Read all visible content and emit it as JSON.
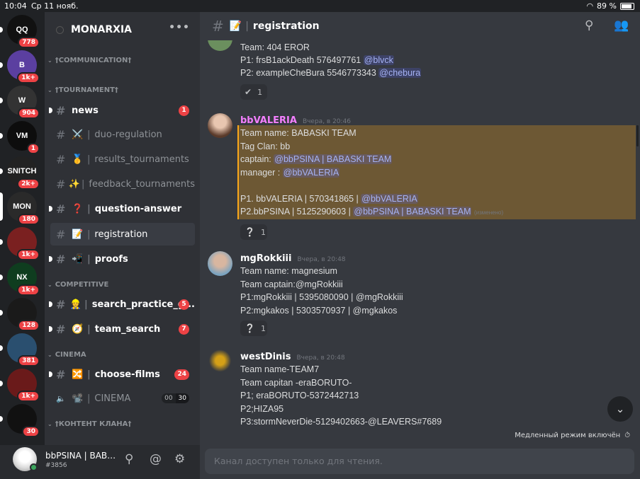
{
  "statusbar": {
    "time": "10:04",
    "date": "Ср 11 нояб.",
    "battery": "89 %",
    "battery_level": 0.89
  },
  "servers": [
    {
      "icon": "qq-server-icon",
      "label": "QQ",
      "bg": "#111111",
      "badge": "778"
    },
    {
      "icon": "b-server-icon",
      "label": "B",
      "bg": "#5b3fa0",
      "badge": "1k+"
    },
    {
      "icon": "w-server-icon",
      "label": "W",
      "bg": "#333333",
      "badge": "904"
    },
    {
      "icon": "vm-server-icon",
      "label": "VM",
      "bg": "#0d0d0d",
      "badge": "1"
    },
    {
      "icon": "snitch-server-icon",
      "label": "SNITCH",
      "bg": "#222",
      "badge": "2k+"
    },
    {
      "icon": "monarxia-server-icon",
      "label": "MON",
      "bg": "#2a2a2a",
      "badge": "180"
    },
    {
      "icon": "red-server-icon",
      "label": "",
      "bg": "#7a2020",
      "badge": "1k+"
    },
    {
      "icon": "nx-server-icon",
      "label": "NX",
      "bg": "#0f3d1f",
      "badge": "1k+"
    },
    {
      "icon": "dark-server-icon",
      "label": "",
      "bg": "#1a1a1a",
      "badge": "128"
    },
    {
      "icon": "blue-server-icon",
      "label": "",
      "bg": "#2a4f6f",
      "badge": "381"
    },
    {
      "icon": "hero-server-icon",
      "label": "",
      "bg": "#6a1a1a",
      "badge": "1k+"
    },
    {
      "icon": "wolf-server-icon",
      "label": "",
      "bg": "#111",
      "badge": "30"
    }
  ],
  "sidebar": {
    "guild_name": "MONARXIA",
    "more": "•••",
    "categories": {
      "communication": "†COMMUNICATION†",
      "tournament": "†TOURNAMENT†",
      "competitive": "COMPETITIVE",
      "cinema": "CINEMA",
      "content": "†КОНТЕНТ КЛАНА†"
    },
    "channels": {
      "news": {
        "name": "news",
        "badge": "1"
      },
      "duo": {
        "emoji": "⚔️",
        "name": "duo-regulation"
      },
      "results": {
        "emoji": "🥇",
        "name": "results_tournaments"
      },
      "feedback": {
        "emoji": "✨",
        "name": "feedback_tournaments"
      },
      "qa": {
        "emoji": "❓",
        "name": "question-answer"
      },
      "registration": {
        "emoji": "📝",
        "name": "registration"
      },
      "proofs": {
        "emoji": "📲",
        "name": "proofs"
      },
      "search": {
        "emoji": "👷",
        "name": "search_practice_g...",
        "badge": "5"
      },
      "team": {
        "emoji": "🧭",
        "name": "team_search",
        "badge": "7"
      },
      "films": {
        "emoji": "🔀",
        "name": "choose-films",
        "badge": "24"
      },
      "cinema": {
        "emoji": "📽️",
        "name": "CINEMA",
        "voice_a": "00",
        "voice_b": "30"
      }
    }
  },
  "user": {
    "name": "bbPSINA | BABAS...",
    "tag": "#3856"
  },
  "channel": {
    "emoji": "📝",
    "name": "registration"
  },
  "messages": {
    "m0": {
      "lines": [
        "Team: 404 EROR"
      ],
      "p1_text": "P1: frsB1ackDeath  576497761 ",
      "p1_mention": "@blvck",
      "p2_text": "P2: exampleCheBura 5546773343 ",
      "p2_mention": "@chebura",
      "reaction": {
        "emoji": "✔",
        "count": "1"
      }
    },
    "m1": {
      "author": "bbVALERIA",
      "author_color": "#f47fff",
      "time": "Вчера, в 20:46",
      "team": "Team name: BABASKI TEAM",
      "tag": "Tag Clan: bb",
      "captain_text": "captain:  ",
      "captain_mention": "@bbPSINA | BABASKI TEAM",
      "manager_text": "manager : ",
      "manager_mention": "@bbVALERIA",
      "p1_text": "P1. bbVALERIA | 570341865 | ",
      "p1_mention": "@bbVALERIA",
      "p2_text": "P2.bbPSINA | 5125290603 | ",
      "p2_mention": "@bbPSINA | BABASKI TEAM",
      "edited": "(изменено)",
      "reaction": {
        "emoji": "❔",
        "count": "1"
      }
    },
    "m2": {
      "author": "mgRokkiii",
      "time": "Вчера, в 20:48",
      "lines": [
        "Team name: magnesium",
        "Team captain:@mgRokkiii",
        "P1:mgRokkiii | 5395080090 | @mgRokkiii",
        "P2:mgkakos | 5303570937 | @mgkakos"
      ],
      "reaction": {
        "emoji": "❔",
        "count": "1"
      }
    },
    "m3": {
      "author": "westDinis",
      "time": "Вчера, в 20:48",
      "lines": [
        "Team name-TEAM7",
        "Team capitan -eraBORUTO-",
        "P1; eraBORUTO-5372442713",
        "P2;HIZA95",
        "P3:stormNeverDie-5129402663-@LEAVERS#7689"
      ]
    }
  },
  "slowmode": "Медленный режим включён",
  "composer_placeholder": "Канал доступен только для чтения."
}
